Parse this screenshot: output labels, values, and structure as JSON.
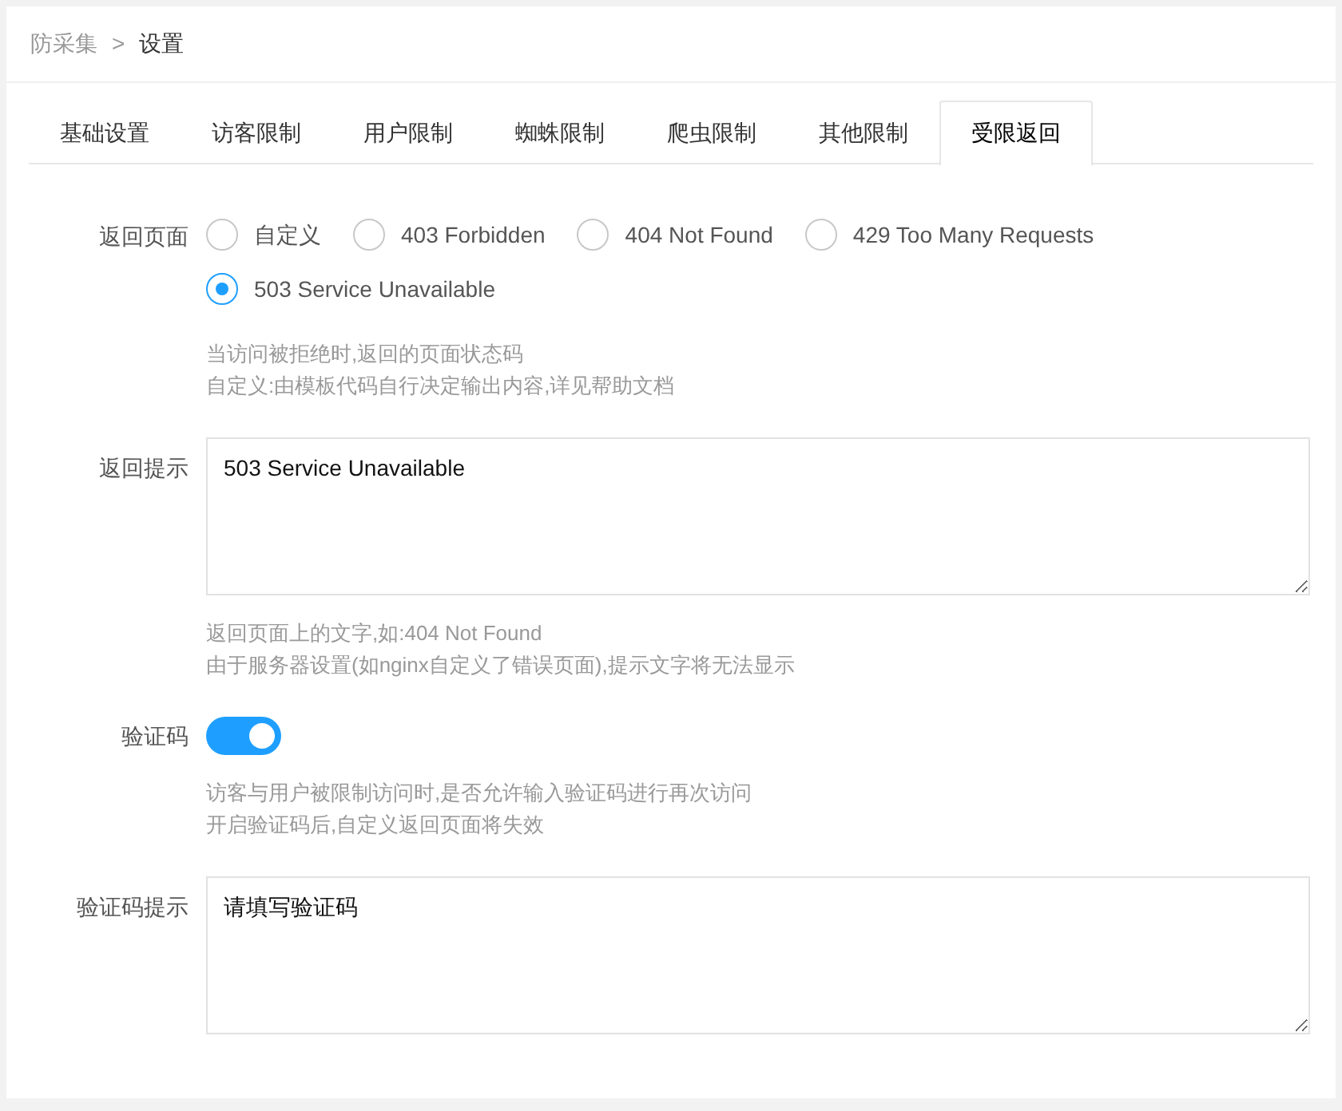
{
  "breadcrumb": [
    {
      "label": "防采集",
      "current": false
    },
    {
      "label": "设置",
      "current": true
    }
  ],
  "breadcrumb_separator": ">",
  "tabs": [
    {
      "label": "基础设置",
      "selected": false
    },
    {
      "label": "访客限制",
      "selected": false
    },
    {
      "label": "用户限制",
      "selected": false
    },
    {
      "label": "蜘蛛限制",
      "selected": false
    },
    {
      "label": "爬虫限制",
      "selected": false
    },
    {
      "label": "其他限制",
      "selected": false
    },
    {
      "label": "受限返回",
      "selected": true
    }
  ],
  "fields": [
    {
      "kind": "radio",
      "label": "返回页面",
      "options": [
        {
          "label": "自定义",
          "selected": false
        },
        {
          "label": "403 Forbidden",
          "selected": false
        },
        {
          "label": "404 Not Found",
          "selected": false
        },
        {
          "label": "429 Too Many Requests",
          "selected": false
        },
        {
          "label": "503 Service Unavailable",
          "selected": true
        }
      ],
      "help": [
        "当访问被拒绝时,返回的页面状态码",
        "自定义:由模板代码自行决定输出内容,详见帮助文档"
      ]
    },
    {
      "kind": "textarea",
      "label": "返回提示",
      "value": "503 Service Unavailable",
      "help": [
        "返回页面上的文字,如:404 Not Found",
        "由于服务器设置(如nginx自定义了错误页面),提示文字将无法显示"
      ]
    },
    {
      "kind": "switch",
      "label": "验证码",
      "on": true,
      "help": [
        "访客与用户被限制访问时,是否允许输入验证码进行再次访问",
        "开启验证码后,自定义返回页面将失效"
      ]
    },
    {
      "kind": "textarea",
      "label": "验证码提示",
      "value": "请填写验证码"
    }
  ]
}
